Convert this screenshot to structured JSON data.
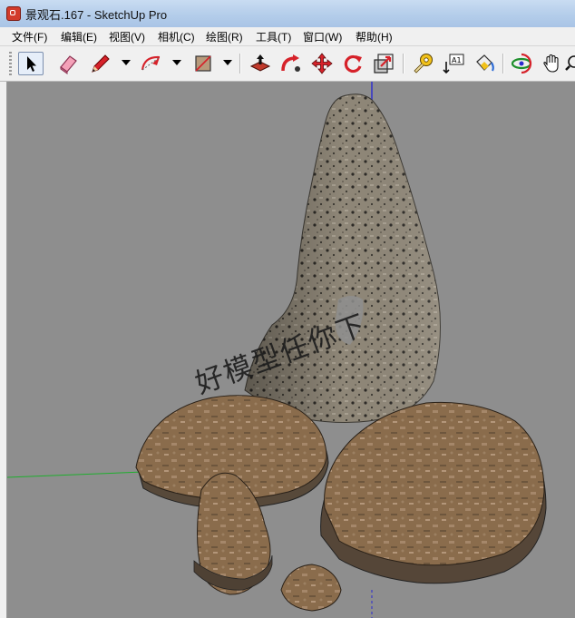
{
  "window": {
    "title": "景观石.167 - SketchUp Pro"
  },
  "menu": {
    "items": [
      {
        "label": "文件(F)"
      },
      {
        "label": "编辑(E)"
      },
      {
        "label": "视图(V)"
      },
      {
        "label": "相机(C)"
      },
      {
        "label": "绘图(R)"
      },
      {
        "label": "工具(T)"
      },
      {
        "label": "窗口(W)"
      },
      {
        "label": "帮助(H)"
      }
    ]
  },
  "toolbar": {
    "tools": [
      {
        "icon": "select-arrow-icon",
        "active": true
      },
      {
        "icon": "eraser-icon"
      },
      {
        "icon": "pencil-line-icon"
      },
      {
        "icon": "arc-icon"
      },
      {
        "icon": "rectangle-icon"
      },
      {
        "icon": "push-pull-icon"
      },
      {
        "icon": "follow-me-icon"
      },
      {
        "icon": "move-icon"
      },
      {
        "icon": "rotate-icon"
      },
      {
        "icon": "scale-icon"
      },
      {
        "icon": "tape-measure-icon"
      },
      {
        "icon": "text-label-icon",
        "label": "A1"
      },
      {
        "icon": "paint-bucket-icon"
      },
      {
        "icon": "orbit-icon"
      },
      {
        "icon": "pan-hand-icon"
      }
    ]
  },
  "viewport": {
    "background": "#8e8e8e",
    "axes": {
      "green": "#1fae2e",
      "red": "#d01a1a",
      "blue": "#2a2ad0"
    },
    "watermark": "好模型任你下"
  }
}
